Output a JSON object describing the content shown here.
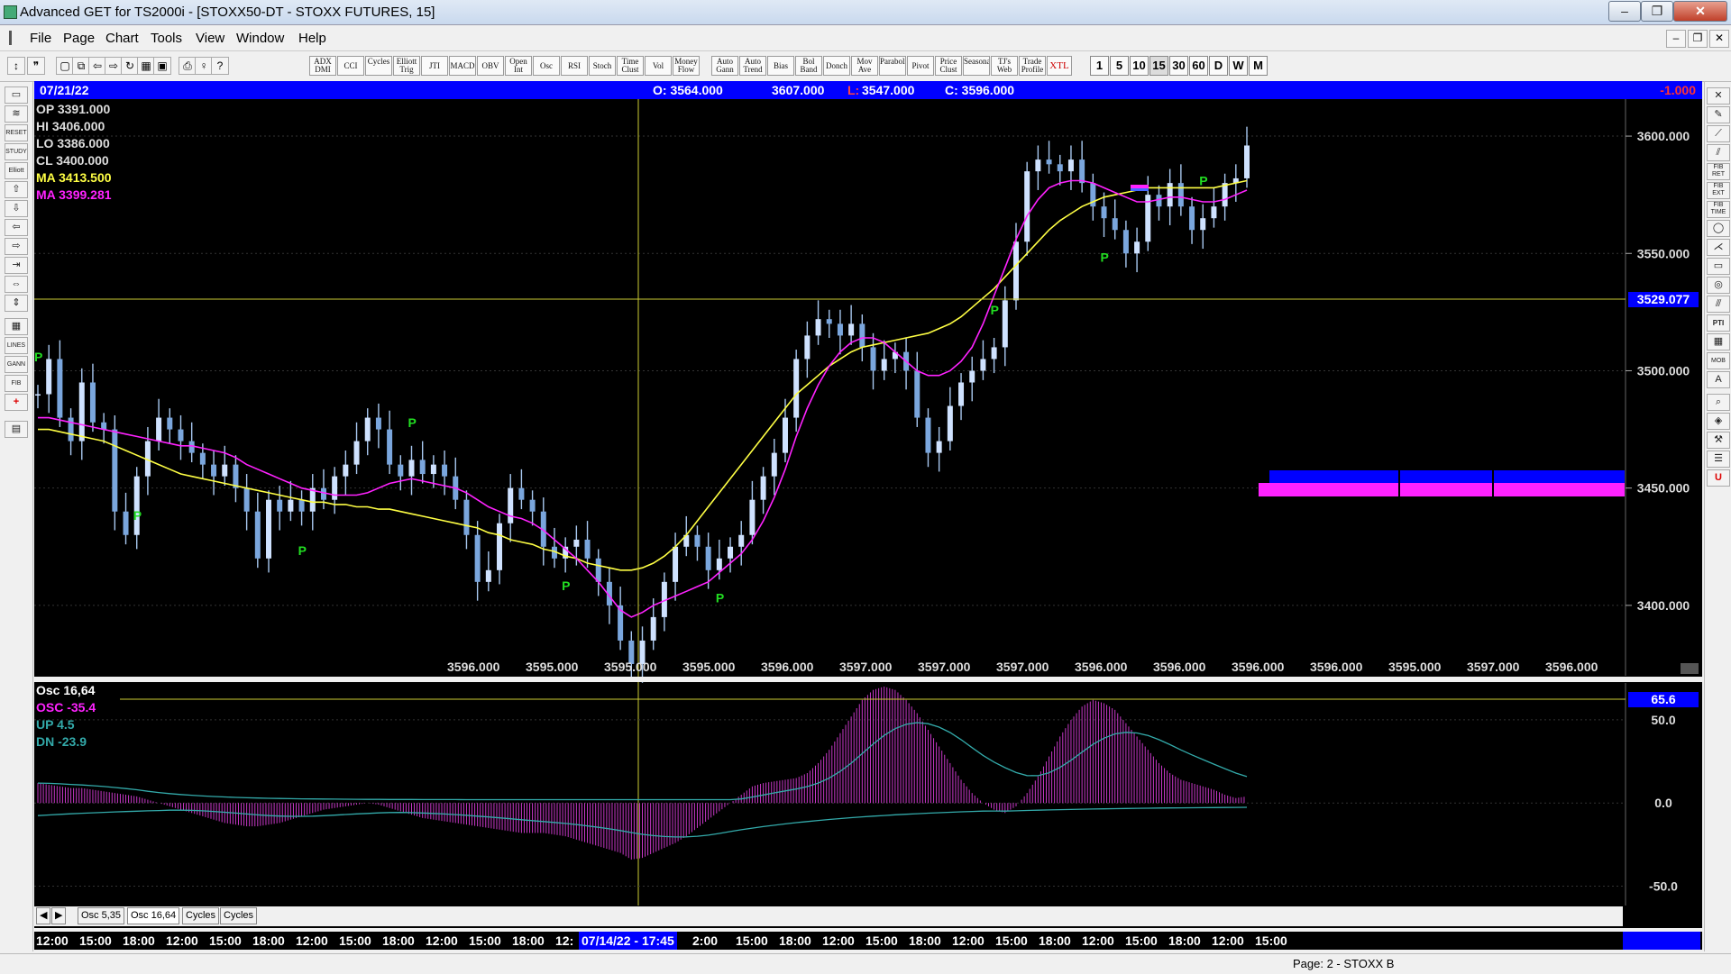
{
  "window": {
    "title": "Advanced GET for TS2000i - [STOXX50-DT - STOXX FUTURES, 15]",
    "minimize": "–",
    "restore": "❐",
    "close": "✕"
  },
  "menu": [
    "File",
    "Page",
    "Chart",
    "Tools",
    "View",
    "Window",
    "Help"
  ],
  "toolbar": {
    "studies": [
      "ADX DMI",
      "CCI",
      "Cycles",
      "Elliott Trig",
      "JTI",
      "MACD",
      "OBV",
      "Open Int",
      "Osc",
      "RSI",
      "Stoch",
      "Time Clust",
      "Vol",
      "Money Flow",
      "Auto Gann",
      "Auto Trend",
      "Bias",
      "Bol Band",
      "Donch",
      "Mov Ave",
      "Parabolic",
      "Pivot",
      "Price Clust",
      "Seasonals",
      "TJ's Web",
      "Trade Profile",
      "XTL"
    ],
    "timeframes": [
      "1",
      "5",
      "10",
      "15",
      "30",
      "60",
      "D",
      "W",
      "M"
    ],
    "selected_timeframe": "15"
  },
  "header": {
    "date": "07/21/22",
    "open": "O: 3564.000",
    "high": "3607.000",
    "low_label": "L:",
    "low": "3547.000",
    "close": "C: 3596.000",
    "change": "-1.000"
  },
  "legend": {
    "op": "OP  3391.000",
    "hi": "HI   3406.000",
    "lo": "LO  3386.000",
    "cl": "CL  3400.000",
    "ma1": "MA  3413.500",
    "ma2": "MA  3399.281"
  },
  "price_axis": {
    "labels": [
      "3600.000",
      "3550.000",
      "3500.000",
      "3450.000",
      "3400.000"
    ],
    "crosshair_value": "3529.077"
  },
  "pivot_label": "P",
  "price_row": [
    "3596.000",
    "3595.000",
    "3595.000",
    "3595.000",
    "3596.000",
    "3597.000",
    "3597.000",
    "3597.000",
    "3596.000",
    "3596.000",
    "3596.000",
    "3596.000",
    "3595.000",
    "3597.000",
    "3596.000"
  ],
  "osc_legend": {
    "title": "Osc 16,64",
    "osc": "OSC -35.4",
    "up": "UP   4.5",
    "dn": "DN   -23.9"
  },
  "osc_axis": {
    "labels": [
      "50.0",
      "0.0",
      "-50.0"
    ],
    "crosshair_value": "65.6"
  },
  "tabs": [
    "Osc 5,35",
    "Osc 16,64",
    "Cycles",
    "Cycles"
  ],
  "time_axis": {
    "labels": [
      "12:00",
      "15:00",
      "18:00",
      "12:00",
      "15:00",
      "18:00",
      "12:00",
      "15:00",
      "18:00",
      "12:00",
      "15:00",
      "18:00",
      "12:",
      "07/14/22 - 17:45",
      "2:00",
      "15:00",
      "18:00",
      "12:00",
      "15:00",
      "18:00",
      "12:00",
      "15:00",
      "18:00",
      "12:00",
      "15:00",
      "18:00",
      "12:00",
      "15:00"
    ]
  },
  "status": {
    "page": "Page: 2 - STOXX B"
  },
  "colors": {
    "ma_yellow": "#ffff44",
    "ma_magenta": "#ff22ff",
    "bars": "#a8c8f0",
    "pivot": "#22dd22",
    "axis_blue": "#0000ff"
  },
  "chart_data": {
    "type": "line",
    "price_range": [
      3370,
      3615
    ],
    "osc_range": [
      -60,
      70
    ],
    "close_path": [
      3490,
      3505,
      3480,
      3470,
      3495,
      3478,
      3475,
      3440,
      3430,
      3455,
      3470,
      3480,
      3475,
      3470,
      3465,
      3460,
      3455,
      3460,
      3450,
      3440,
      3420,
      3445,
      3440,
      3445,
      3440,
      3450,
      3445,
      3455,
      3460,
      3470,
      3480,
      3475,
      3460,
      3455,
      3462,
      3456,
      3460,
      3455,
      3445,
      3430,
      3410,
      3415,
      3435,
      3450,
      3445,
      3440,
      3425,
      3420,
      3425,
      3428,
      3420,
      3410,
      3400,
      3385,
      3375,
      3385,
      3395,
      3410,
      3425,
      3430,
      3425,
      3415,
      3420,
      3425,
      3430,
      3445,
      3455,
      3465,
      3480,
      3505,
      3515,
      3522,
      3520,
      3515,
      3520,
      3510,
      3500,
      3505,
      3508,
      3500,
      3480,
      3465,
      3470,
      3485,
      3495,
      3500,
      3505,
      3510,
      3530,
      3555,
      3585,
      3590,
      3588,
      3585,
      3590,
      3580,
      3570,
      3565,
      3560,
      3550,
      3555,
      3575,
      3570,
      3580,
      3570,
      3560,
      3565,
      3570,
      3580,
      3582,
      3596
    ],
    "ma_yellow": [
      3475,
      3475,
      3474,
      3473,
      3472,
      3471,
      3470,
      3468,
      3466,
      3464,
      3462,
      3460,
      3458,
      3456,
      3455,
      3454,
      3453,
      3452,
      3451,
      3450,
      3449,
      3448,
      3447,
      3446,
      3445,
      3444,
      3444,
      3443,
      3443,
      3442,
      3442,
      3441,
      3441,
      3440,
      3439,
      3438,
      3437,
      3436,
      3435,
      3434,
      3433,
      3431,
      3430,
      3428,
      3427,
      3426,
      3424,
      3423,
      3421,
      3420,
      3418,
      3417,
      3416,
      3415,
      3415,
      3416,
      3418,
      3421,
      3425,
      3430,
      3436,
      3442,
      3448,
      3454,
      3460,
      3466,
      3472,
      3478,
      3484,
      3490,
      3494,
      3498,
      3502,
      3505,
      3508,
      3510,
      3511,
      3512,
      3513,
      3514,
      3515,
      3516,
      3518,
      3520,
      3523,
      3527,
      3531,
      3535,
      3540,
      3545,
      3550,
      3555,
      3560,
      3564,
      3567,
      3570,
      3572,
      3574,
      3575,
      3576,
      3577,
      3578,
      3578,
      3578,
      3578,
      3578,
      3578,
      3578,
      3579,
      3580,
      3581
    ],
    "ma_magenta": [
      3480,
      3480,
      3479,
      3478,
      3477,
      3476,
      3475,
      3474,
      3473,
      3472,
      3471,
      3470,
      3469,
      3468,
      3468,
      3467,
      3466,
      3465,
      3463,
      3460,
      3458,
      3456,
      3454,
      3452,
      3450,
      3449,
      3448,
      3447,
      3447,
      3447,
      3448,
      3450,
      3452,
      3453,
      3454,
      3453,
      3452,
      3451,
      3450,
      3448,
      3445,
      3442,
      3440,
      3438,
      3437,
      3435,
      3432,
      3428,
      3424,
      3420,
      3415,
      3410,
      3404,
      3398,
      3395,
      3397,
      3400,
      3402,
      3404,
      3406,
      3408,
      3410,
      3414,
      3418,
      3422,
      3428,
      3436,
      3446,
      3458,
      3472,
      3484,
      3494,
      3502,
      3508,
      3512,
      3514,
      3514,
      3512,
      3508,
      3504,
      3500,
      3498,
      3498,
      3500,
      3504,
      3510,
      3520,
      3532,
      3544,
      3556,
      3566,
      3573,
      3578,
      3580,
      3581,
      3581,
      3580,
      3578,
      3576,
      3574,
      3572,
      3572,
      3573,
      3574,
      3574,
      3573,
      3572,
      3572,
      3573,
      3575,
      3577
    ],
    "osc_values": [
      12,
      11,
      10,
      9,
      9,
      8,
      7,
      6,
      5,
      4,
      2,
      0,
      -2,
      -4,
      -6,
      -8,
      -10,
      -12,
      -13,
      -14,
      -14,
      -13,
      -12,
      -10,
      -8,
      -6,
      -4,
      -3,
      -2,
      -1,
      0,
      -1,
      -3,
      -5,
      -7,
      -9,
      -10,
      -11,
      -12,
      -13,
      -14,
      -15,
      -16,
      -17,
      -18,
      -18,
      -18,
      -19,
      -20,
      -22,
      -24,
      -26,
      -28,
      -30,
      -34,
      -33,
      -30,
      -27,
      -24,
      -20,
      -15,
      -10,
      -5,
      0,
      5,
      10,
      12,
      13,
      14,
      15,
      18,
      24,
      32,
      42,
      52,
      62,
      68,
      70,
      68,
      62,
      54,
      44,
      34,
      24,
      14,
      6,
      0,
      -4,
      -6,
      -2,
      6,
      16,
      28,
      40,
      50,
      58,
      62,
      60,
      56,
      48,
      40,
      32,
      24,
      18,
      14,
      12,
      10,
      8,
      5,
      3,
      4
    ]
  }
}
